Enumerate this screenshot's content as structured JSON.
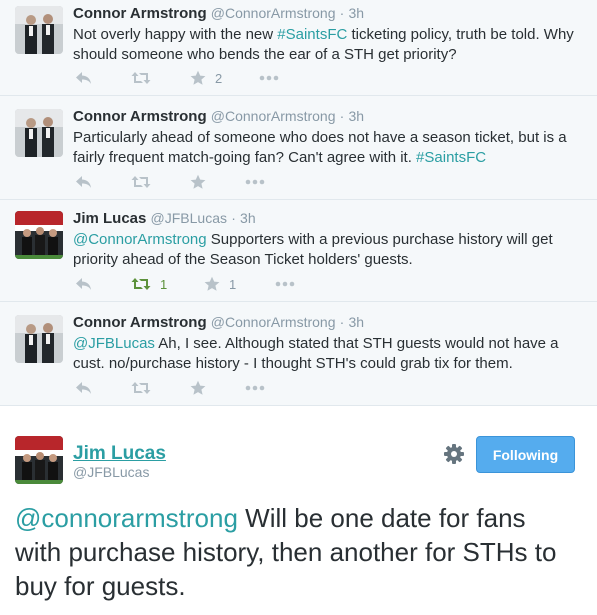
{
  "colors": {
    "link": "#2b9ea3",
    "retweet_green": "#5c913b",
    "follow_blue": "#55acee",
    "muted": "#8899a6"
  },
  "icons": {
    "reply": "reply-icon",
    "retweet": "retweet-icon",
    "favorite": "star-icon",
    "more": "more-dots-icon",
    "settings": "gear-icon"
  },
  "tweets": [
    {
      "name": "Connor Armstrong",
      "handle": "@ConnorArmstrong",
      "sep": "·",
      "time": "3h",
      "text_1": "Not overly happy with the new ",
      "link_1": "#SaintsFC",
      "text_2": " ticketing policy, truth be told. Why should someone who bends the ear of a STH get priority?",
      "retweets": "",
      "favorites": "2"
    },
    {
      "name": "Connor Armstrong",
      "handle": "@ConnorArmstrong",
      "sep": "·",
      "time": "3h",
      "text_1": "Particularly ahead of someone who does not have a season ticket, but is a fairly frequent match-going fan? Can't agree with it. ",
      "link_1": "#SaintsFC",
      "text_2": "",
      "retweets": "",
      "favorites": ""
    },
    {
      "name": "Jim Lucas",
      "handle": "@JFBLucas",
      "sep": "·",
      "time": "3h",
      "link_0": "@ConnorArmstrong",
      "text_1": " Supporters with a previous purchase history will get priority ahead of the Season Ticket holders' guests.",
      "retweets": "1",
      "favorites": "1"
    },
    {
      "name": "Connor Armstrong",
      "handle": "@ConnorArmstrong",
      "sep": "·",
      "time": "3h",
      "link_0": "@JFBLucas",
      "text_1": " Ah, I see. Although stated that STH guests would not have a cust. no/purchase history - I thought STH's could grab tix for them.",
      "retweets": "",
      "favorites": ""
    }
  ],
  "main_tweet": {
    "name": "Jim Lucas",
    "handle": "@JFBLucas",
    "follow_label": "Following",
    "mention": "@connorarmstrong",
    "text": " Will be one date for fans with purchase history, then another for STHs to buy for guests."
  }
}
